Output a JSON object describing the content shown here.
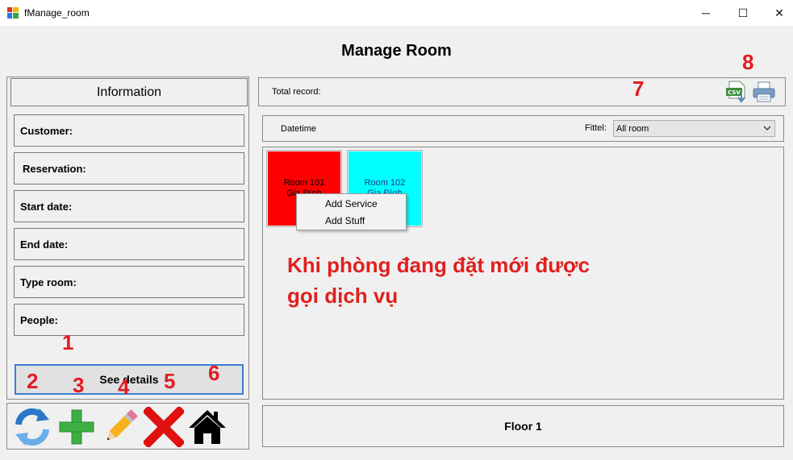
{
  "window": {
    "title": "fManage_room",
    "minimize_symbol": "─",
    "maximize_symbol": "☐",
    "close_symbol": "✕"
  },
  "page_title": "Manage Room",
  "info": {
    "header": "Information",
    "fields": [
      "Customer:",
      "Reservation:",
      "Start date:",
      "End date:",
      "Type room:",
      "People:"
    ],
    "details_button": "See details"
  },
  "toolbar": {
    "icons": [
      "refresh-icon",
      "add-icon",
      "edit-icon",
      "delete-icon",
      "home-icon"
    ]
  },
  "records": {
    "total_label": "Total record:",
    "export_icons": [
      "csv-export-icon",
      "print-icon"
    ]
  },
  "filter": {
    "datetime_label": "Datetime",
    "filter_label": "Fittel:",
    "selected_value": "All room"
  },
  "rooms": [
    {
      "name": "Room 101",
      "status": "Gia Đình",
      "color": "#ff0000"
    },
    {
      "name": "Room 102",
      "status": "Gia Đình",
      "color": "#00ffff"
    }
  ],
  "context_menu": [
    "Add Service",
    "Add Stuff"
  ],
  "annotation": {
    "line1": "Khi phòng đang đặt mới được",
    "line2": "gọi dịch vụ"
  },
  "markers": [
    "1",
    "2",
    "3",
    "4",
    "5",
    "6",
    "7",
    "8"
  ],
  "floor_label": "Floor 1",
  "colors": {
    "background": "#f0f0f0",
    "annotation_red": "#e31b23",
    "focus_blue": "#3a7fd0"
  }
}
